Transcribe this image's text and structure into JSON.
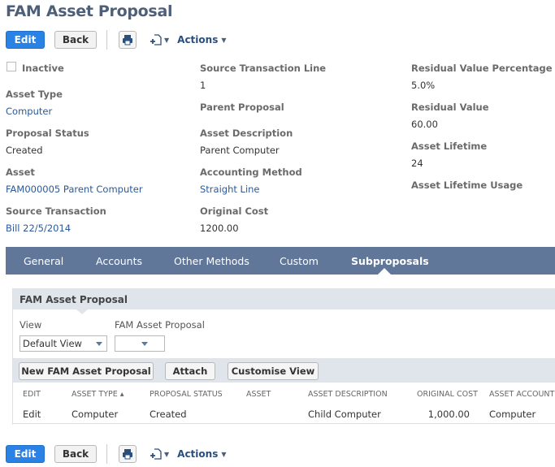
{
  "page": {
    "title": "FAM Asset Proposal"
  },
  "toolbar": {
    "edit_label": "Edit",
    "back_label": "Back",
    "actions_label": "Actions"
  },
  "fields": {
    "inactive_label": "Inactive",
    "inactive_checked": false,
    "asset_type": {
      "label": "Asset Type",
      "value": "Computer"
    },
    "proposal_status": {
      "label": "Proposal Status",
      "value": "Created"
    },
    "asset": {
      "label": "Asset",
      "value": "FAM000005 Parent Computer"
    },
    "source_transaction": {
      "label": "Source Transaction",
      "value": "Bill 22/5/2014"
    },
    "source_transaction_line": {
      "label": "Source Transaction Line",
      "value": "1"
    },
    "parent_proposal": {
      "label": "Parent Proposal",
      "value": ""
    },
    "asset_description": {
      "label": "Asset Description",
      "value": "Parent Computer"
    },
    "accounting_method": {
      "label": "Accounting Method",
      "value": "Straight Line"
    },
    "original_cost": {
      "label": "Original Cost",
      "value": "1200.00"
    },
    "residual_value_percentage": {
      "label": "Residual Value Percentage",
      "value": "5.0%"
    },
    "residual_value": {
      "label": "Residual Value",
      "value": "60.00"
    },
    "asset_lifetime": {
      "label": "Asset Lifetime",
      "value": "24"
    },
    "asset_lifetime_usage": {
      "label": "Asset Lifetime Usage",
      "value": ""
    }
  },
  "tabs": [
    {
      "label": "General",
      "active": false
    },
    {
      "label": "Accounts",
      "active": false
    },
    {
      "label": "Other Methods",
      "active": false
    },
    {
      "label": "Custom",
      "active": false
    },
    {
      "label": "Subproposals",
      "active": true
    }
  ],
  "subtab": {
    "title": "FAM Asset Proposal",
    "view_label": "View",
    "view_value": "Default View",
    "filter_label": "FAM Asset Proposal",
    "filter_value": "",
    "buttons": {
      "new": "New FAM Asset Proposal",
      "attach": "Attach",
      "customise": "Customise View"
    },
    "columns": [
      "EDIT",
      "ASSET TYPE ▴",
      "PROPOSAL STATUS",
      "ASSET",
      "ASSET DESCRIPTION",
      "ORIGINAL COST",
      "ASSET ACCOUNT"
    ],
    "rows": [
      {
        "edit": "Edit",
        "asset_type": "Computer",
        "proposal_status": "Created",
        "asset": "",
        "asset_description": "Child Computer",
        "original_cost": "1,000.00",
        "asset_account": "Computer"
      }
    ]
  }
}
